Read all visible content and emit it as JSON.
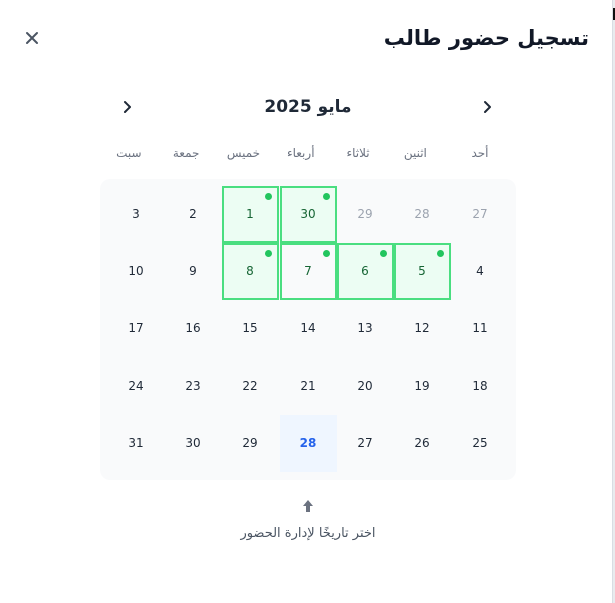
{
  "dialog": {
    "title": "تسجيل حضور طالب",
    "close_icon": "close-icon"
  },
  "calendar": {
    "month_title": "مايو 2025",
    "prev_icon": "chevron-left-icon",
    "next_icon": "chevron-right-icon",
    "weekdays": [
      "أحد",
      "اثنين",
      "ثلاثاء",
      "أربعاء",
      "خميس",
      "جمعة",
      "سبت"
    ],
    "weeks": [
      [
        {
          "d": "27",
          "muted": true
        },
        {
          "d": "28",
          "muted": true
        },
        {
          "d": "29",
          "muted": true
        },
        {
          "d": "30",
          "attended": true
        },
        {
          "d": "1",
          "attended": true
        },
        {
          "d": "2"
        },
        {
          "d": "3"
        }
      ],
      [
        {
          "d": "4"
        },
        {
          "d": "5",
          "attended": true
        },
        {
          "d": "6",
          "attended": true
        },
        {
          "d": "7",
          "attended": true,
          "plain": true
        },
        {
          "d": "8",
          "attended": true
        },
        {
          "d": "9"
        },
        {
          "d": "10"
        }
      ],
      [
        {
          "d": "11"
        },
        {
          "d": "12"
        },
        {
          "d": "13"
        },
        {
          "d": "14"
        },
        {
          "d": "15"
        },
        {
          "d": "16"
        },
        {
          "d": "17"
        }
      ],
      [
        {
          "d": "18"
        },
        {
          "d": "19"
        },
        {
          "d": "20"
        },
        {
          "d": "21"
        },
        {
          "d": "22"
        },
        {
          "d": "23"
        },
        {
          "d": "24"
        }
      ],
      [
        {
          "d": "25"
        },
        {
          "d": "26"
        },
        {
          "d": "27"
        },
        {
          "d": "28",
          "today": true
        },
        {
          "d": "29"
        },
        {
          "d": "30"
        },
        {
          "d": "31"
        }
      ]
    ],
    "colors": {
      "attended_border": "#4ade80",
      "attended_bg": "#ecfdf3",
      "dot": "#22c55e",
      "today_text": "#2563eb"
    }
  },
  "hint": {
    "icon": "arrow-up-icon",
    "text": "اختر تاريخًا لإدارة الحضور"
  }
}
